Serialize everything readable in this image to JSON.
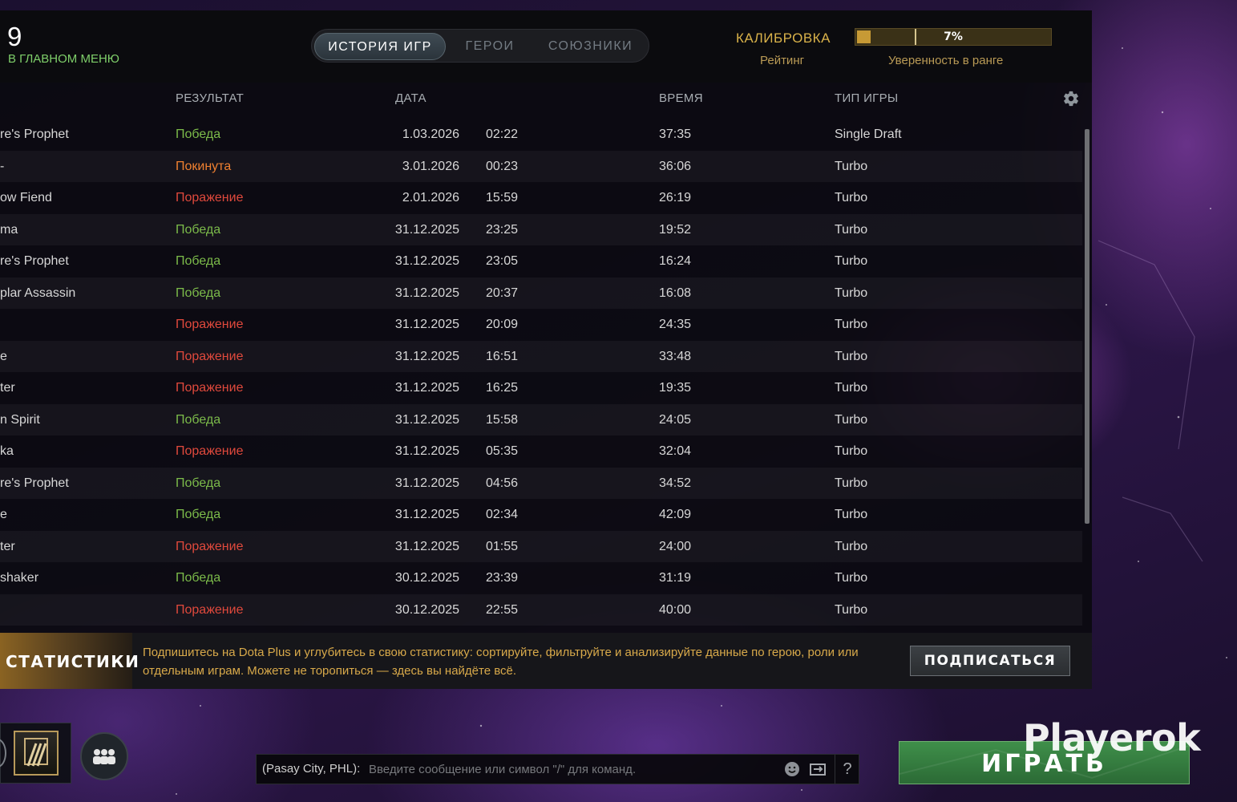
{
  "header": {
    "level": "9",
    "back_label": "В ГЛАВНОМ МЕНЮ"
  },
  "tabs": [
    {
      "label": "ИСТОРИЯ ИГР",
      "active": true
    },
    {
      "label": "ГЕРОИ",
      "active": false
    },
    {
      "label": "СОЮЗНИКИ",
      "active": false
    }
  ],
  "calibration": {
    "title": "КАЛИБРОВКА",
    "rating_label": "Рейтинг",
    "confidence_label": "Уверенность в ранге",
    "confidence_value": "7%",
    "confidence_fraction": 0.07,
    "colors": {
      "bar_fill": "#c79a35",
      "bar_bg": "#3a3117",
      "text": "#d9b24a"
    }
  },
  "table": {
    "columns": {
      "result": "РЕЗУЛЬТАТ",
      "date": "ДАТА",
      "duration": "ВРЕМЯ",
      "game_type": "ТИП ИГРЫ"
    },
    "rows": [
      {
        "hero": "re's Prophet",
        "result": "Победа",
        "kind": "win",
        "date": "1.03.2026",
        "time": "02:22",
        "duration": "37:35",
        "type": "Single Draft"
      },
      {
        "hero": "-",
        "result": "Покинута",
        "kind": "abandon",
        "date": "3.01.2026",
        "time": "00:23",
        "duration": "36:06",
        "type": "Turbo"
      },
      {
        "hero": "ow Fiend",
        "result": "Поражение",
        "kind": "loss",
        "date": "2.01.2026",
        "time": "15:59",
        "duration": "26:19",
        "type": "Turbo"
      },
      {
        "hero": "ma",
        "result": "Победа",
        "kind": "win",
        "date": "31.12.2025",
        "time": "23:25",
        "duration": "19:52",
        "type": "Turbo"
      },
      {
        "hero": "re's Prophet",
        "result": "Победа",
        "kind": "win",
        "date": "31.12.2025",
        "time": "23:05",
        "duration": "16:24",
        "type": "Turbo"
      },
      {
        "hero": "plar Assassin",
        "result": "Победа",
        "kind": "win",
        "date": "31.12.2025",
        "time": "20:37",
        "duration": "16:08",
        "type": "Turbo"
      },
      {
        "hero": "",
        "result": "Поражение",
        "kind": "loss",
        "date": "31.12.2025",
        "time": "20:09",
        "duration": "24:35",
        "type": "Turbo"
      },
      {
        "hero": "e",
        "result": "Поражение",
        "kind": "loss",
        "date": "31.12.2025",
        "time": "16:51",
        "duration": "33:48",
        "type": "Turbo"
      },
      {
        "hero": "ter",
        "result": "Поражение",
        "kind": "loss",
        "date": "31.12.2025",
        "time": "16:25",
        "duration": "19:35",
        "type": "Turbo"
      },
      {
        "hero": "n Spirit",
        "result": "Победа",
        "kind": "win",
        "date": "31.12.2025",
        "time": "15:58",
        "duration": "24:05",
        "type": "Turbo"
      },
      {
        "hero": "ka",
        "result": "Поражение",
        "kind": "loss",
        "date": "31.12.2025",
        "time": "05:35",
        "duration": "32:04",
        "type": "Turbo"
      },
      {
        "hero": "re's Prophet",
        "result": "Победа",
        "kind": "win",
        "date": "31.12.2025",
        "time": "04:56",
        "duration": "34:52",
        "type": "Turbo"
      },
      {
        "hero": "e",
        "result": "Победа",
        "kind": "win",
        "date": "31.12.2025",
        "time": "02:34",
        "duration": "42:09",
        "type": "Turbo"
      },
      {
        "hero": "ter",
        "result": "Поражение",
        "kind": "loss",
        "date": "31.12.2025",
        "time": "01:55",
        "duration": "24:00",
        "type": "Turbo"
      },
      {
        "hero": "shaker",
        "result": "Победа",
        "kind": "win",
        "date": "30.12.2025",
        "time": "23:39",
        "duration": "31:19",
        "type": "Turbo"
      },
      {
        "hero": "",
        "result": "Поражение",
        "kind": "loss",
        "date": "30.12.2025",
        "time": "22:55",
        "duration": "40:00",
        "type": "Turbo"
      }
    ],
    "result_colors": {
      "win": "#7cbb4a",
      "loss": "#e0493c",
      "abandon": "#ef8030"
    }
  },
  "banner": {
    "title": "СТАТИСТИКИ",
    "text": "Подпишитесь на Dota Plus и углубитесь в свою статистику: сортируйте, фильтруйте и анализируйте данные по герою, роли или отдельным играм. Можете не торопиться — здесь вы найдёте всё.",
    "button_label": "ПОДПИСАТЬСЯ"
  },
  "chat": {
    "channel": "(Pasay City, PHL):",
    "placeholder": "Введите сообщение или символ \"/\" для команд.",
    "icons": [
      "emoji-icon",
      "chat-wheel-icon",
      "help-icon"
    ],
    "help_glyph": "?"
  },
  "play_button": {
    "label": "ИГРАТЬ"
  },
  "watermark": "Playerok"
}
